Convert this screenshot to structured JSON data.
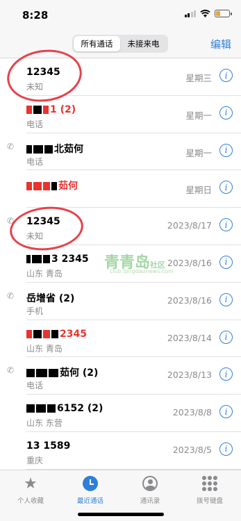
{
  "status": {
    "time": "8:28"
  },
  "nav": {
    "segments": [
      "所有通话",
      "未接来电"
    ],
    "edit": "编辑"
  },
  "calls": [
    {
      "name": "12345",
      "sub": "未知",
      "date": "星期三",
      "missed": false,
      "icon": false
    },
    {
      "name": "1 (2)",
      "sub": "电话",
      "date": "星期一",
      "missed": true,
      "icon": false
    },
    {
      "name": "北茹何",
      "sub": "电话",
      "date": "星期一",
      "missed": false,
      "icon": true
    },
    {
      "name": "茹何",
      "sub": "",
      "date": "星期日",
      "missed": true,
      "icon": false
    },
    {
      "name": "12345",
      "sub": "未知",
      "date": "2023/8/17",
      "missed": false,
      "icon": true
    },
    {
      "name": "3 2345",
      "sub": "山东 青岛",
      "date": "2023/8/16",
      "missed": false,
      "icon": false
    },
    {
      "name": "岳增省 (2)",
      "sub": "手机",
      "date": "2023/8/16",
      "missed": false,
      "icon": true
    },
    {
      "name": "2345",
      "sub": "山东 青岛",
      "date": "2023/8/14",
      "missed": true,
      "icon": false
    },
    {
      "name": "茹何 (2)",
      "sub": "电话",
      "date": "2023/8/13",
      "missed": false,
      "icon": true
    },
    {
      "name": "6152 (2)",
      "sub": "山东 东营",
      "date": "2023/8/8",
      "missed": false,
      "icon": false
    },
    {
      "name": "13 1589",
      "sub": "重庆",
      "date": "2023/8/5",
      "missed": false,
      "icon": false
    }
  ],
  "watermark": {
    "main": "青青岛",
    "tag": "社区",
    "url": "club.qingdaonews.com"
  },
  "tabs": [
    "个人收藏",
    "最近通话",
    "通讯录",
    "拨号键盘"
  ]
}
